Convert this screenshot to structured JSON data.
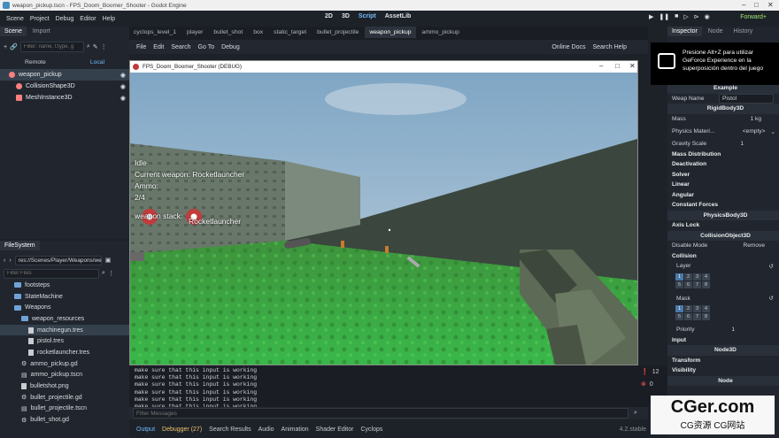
{
  "window": {
    "title": "weapon_pickup.tscn - FPS_Doom_Boomer_Shooter - Godot Engine"
  },
  "menubar": {
    "items": [
      "Scene",
      "Project",
      "Debug",
      "Editor",
      "Help"
    ],
    "center": [
      "2D",
      "3D",
      "Script",
      "AssetLib"
    ],
    "renderer": "Forward+"
  },
  "scene_dock": {
    "tabs": [
      "Scene",
      "Import"
    ],
    "filter_placeholder": "Filter: name, t:type, g",
    "remote": "Remote",
    "local": "Local",
    "nodes": [
      "weapon_pickup",
      "CollisionShape3D",
      "MeshInstance3D"
    ]
  },
  "filesystem": {
    "tab": "FileSystem",
    "path": "res://Scenes/Player/Weapons/we",
    "filter_placeholder": "Filter Files",
    "items": [
      {
        "name": "footsteps",
        "type": "folder",
        "indent": 2
      },
      {
        "name": "StateMachine",
        "type": "folder",
        "indent": 2
      },
      {
        "name": "Weapons",
        "type": "folder",
        "indent": 2
      },
      {
        "name": "weapon_resources",
        "type": "folder",
        "indent": 3
      },
      {
        "name": "machinegun.tres",
        "type": "file",
        "indent": 4,
        "selected": true
      },
      {
        "name": "pistol.tres",
        "type": "file",
        "indent": 4
      },
      {
        "name": "rocketlauncher.tres",
        "type": "file",
        "indent": 4
      },
      {
        "name": "ammo_pickup.gd",
        "type": "gear",
        "indent": 3
      },
      {
        "name": "ammo_pickup.tscn",
        "type": "scene",
        "indent": 3
      },
      {
        "name": "bulletshot.png",
        "type": "file",
        "indent": 3
      },
      {
        "name": "bullet_projectile.gd",
        "type": "gear",
        "indent": 3
      },
      {
        "name": "bullet_projectile.tscn",
        "type": "scene",
        "indent": 3
      },
      {
        "name": "bullet_shot.gd",
        "type": "gear",
        "indent": 3
      }
    ]
  },
  "script_tabs": [
    "cyclops_level_1",
    "player",
    "bullet_shot",
    "box",
    "static_target",
    "bullet_projectile",
    "weapon_pickup",
    "ammo_pickup"
  ],
  "script_menu": [
    "File",
    "Edit",
    "Search",
    "Go To",
    "Debug"
  ],
  "script_right": {
    "docs": "Online Docs",
    "help": "Search Help"
  },
  "game": {
    "title": "FPS_Doom_Boomer_Shooter (DEBUG)",
    "hud": {
      "state": "Idle",
      "current_weapon": "Current weapon:  Rocketlauncher",
      "ammo_label": "Ammo:",
      "ammo": "2/4",
      "stack_label": "weapon stack:",
      "stack_item": "Rocketlauncher"
    }
  },
  "output": {
    "lines": [
      "make sure that this input is working",
      "make sure that this input is working",
      "make sure that this input is working",
      "make sure that this input is working",
      "make sure that this input is working",
      "make sure that this input is working"
    ],
    "filter_placeholder": "Filter Messages",
    "warn_count": "12",
    "err_count": "0"
  },
  "bottom_tabs": [
    "Output",
    "Debugger (27)",
    "Search Results",
    "Audio",
    "Animation",
    "Shader Editor",
    "Cyclops"
  ],
  "version": "4.2.stable",
  "inspector": {
    "tabs": [
      "Inspector",
      "Node",
      "History"
    ],
    "weap_name_label": "Weap Name",
    "weap_name_value": "Pistol",
    "header_example": "Example",
    "rigidbody": "RigidBody3D",
    "mass_label": "Mass",
    "mass_value": "1 kg",
    "physmat_label": "Physics Materi...",
    "physmat_value": "<empty>",
    "gravity_label": "Gravity Scale",
    "gravity_value": "1",
    "sections": [
      "Mass Distribution",
      "Deactivation",
      "Solver",
      "Linear",
      "Angular",
      "Constant Forces"
    ],
    "physicsbody": "PhysicsBody3D",
    "axis_lock": "Axis Lock",
    "collisionobject": "CollisionObject3D",
    "disable_mode_label": "Disable Mode",
    "disable_mode_value": "Remove",
    "collision": "Collision",
    "layer": "Layer",
    "mask": "Mask",
    "layer_cells": [
      "1",
      "2",
      "3",
      "4",
      "5",
      "6",
      "7",
      "8"
    ],
    "priority_label": "Priority",
    "priority_value": "1",
    "input": "Input",
    "node3d": "Node3D",
    "transform": "Transform",
    "visibility": "Visibility",
    "node": "Node"
  },
  "nvidia": {
    "text": "Presione Alt+Z para utilizar GeForce Experience en la superposición dentro del juego"
  },
  "watermark": {
    "line1": "CGer.com",
    "line2": "CG资源 CG网站"
  }
}
